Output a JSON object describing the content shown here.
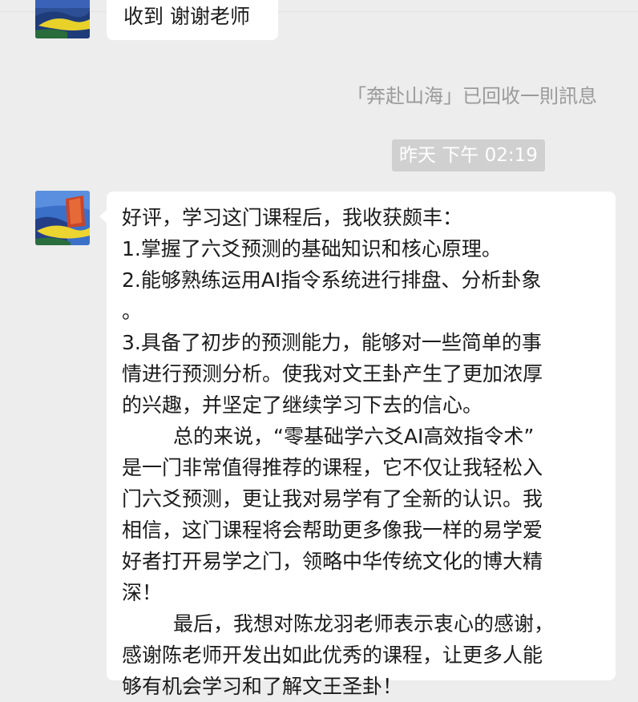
{
  "messages": [
    {
      "id": "msg1",
      "text": "收到 谢谢老师"
    },
    {
      "id": "msg2",
      "lines": [
        "好评，学习这门课程后，我收获颇丰：",
        "1.掌握了六爻预测的基础知识和核心原理。",
        "2.能够熟练运用AI指令系统进行排盘、分析卦象",
        "。",
        "3.具备了初步的预测能力，能够对一些简单的事",
        "情进行预测分析。使我对文王卦产生了更加浓厚",
        "的兴趣，并坚定了继续学习下去的信心。",
        "总的来说，“零基础学六爻AI高效指令术”",
        "是一门非常值得推荐的课程，它不仅让我轻松入",
        "门六爻预测，更让我对易学有了全新的认识。我",
        "相信，这门课程将会帮助更多像我一样的易学爱",
        "好者打开易学之门，领略中华传统文化的博大精",
        "深！",
        "最后，我想对陈龙羽老师表示衷心的感谢，",
        "感谢陈老师开发出如此优秀的课程，让更多人能",
        "够有机会学习和了解文王圣卦！"
      ]
    }
  ],
  "system_notice": "「奔赴山海」已回收一則訊息",
  "timestamp": "昨天 下午 02:19",
  "colors": {
    "background": "#ededed",
    "bubble": "#ffffff",
    "notice_text": "#9a9a9a",
    "timestamp_bg": "#d0d0d0"
  },
  "icons": {
    "avatar": "landscape-avatar"
  }
}
